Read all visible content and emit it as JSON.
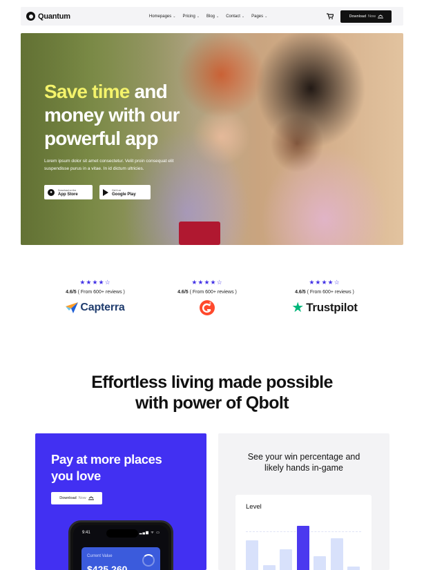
{
  "nav": {
    "logo": "Quantum",
    "menu": [
      {
        "label": "Homepages"
      },
      {
        "label": "Pricing"
      },
      {
        "label": "Blog"
      },
      {
        "label": "Contact"
      },
      {
        "label": "Pages"
      }
    ],
    "download": {
      "label": "Download",
      "suffix": "Now"
    }
  },
  "hero": {
    "title_highlight": "Save time",
    "title_rest": " and money with our powerful app",
    "subtitle": "Lorem ipsum dolor sit amet consectetur. Velit proin consequat elit suspendisse purus in a vitae. In id dictum ultricies.",
    "app_store": {
      "small": "Download on the",
      "big": "App Store"
    },
    "google_play": {
      "small": "Get it on",
      "big": "Google Play"
    }
  },
  "ratings": [
    {
      "stars": "★★★★☆",
      "score": "4.6/5",
      "reviews": " ( From 600+ reviews )",
      "brand": "Capterra"
    },
    {
      "stars": "★★★★☆",
      "score": "4.6/5",
      "reviews": " ( From 600+ reviews )",
      "brand": "G2"
    },
    {
      "stars": "★★★★☆",
      "score": "4.6/5",
      "reviews": " ( From 600+ reviews )",
      "brand": "Trustpilot"
    }
  ],
  "section": {
    "title_line1": "Effortless living made possible",
    "title_line2": "with power of Qbolt"
  },
  "card_pay": {
    "title": "Pay at more places you love",
    "button": {
      "label": "Download",
      "suffix": "Now"
    },
    "phone": {
      "time": "9:41",
      "status": "▂▄▆ ᯤ ▭",
      "current_value_label": "Current Value",
      "current_value": "$425,260"
    }
  },
  "card_win": {
    "title": "See your win percentage and likely hands in-game",
    "panel_label": "Level",
    "bars": [
      0.42,
      0.14,
      0.32,
      0.58,
      0.24,
      0.44,
      0.12
    ],
    "active_bar": 3
  },
  "colors": {
    "accent": "#4230f2",
    "highlight": "#f4f36b",
    "bar_active": "#4b39ef",
    "bar_idle": "#d8e1fb"
  }
}
